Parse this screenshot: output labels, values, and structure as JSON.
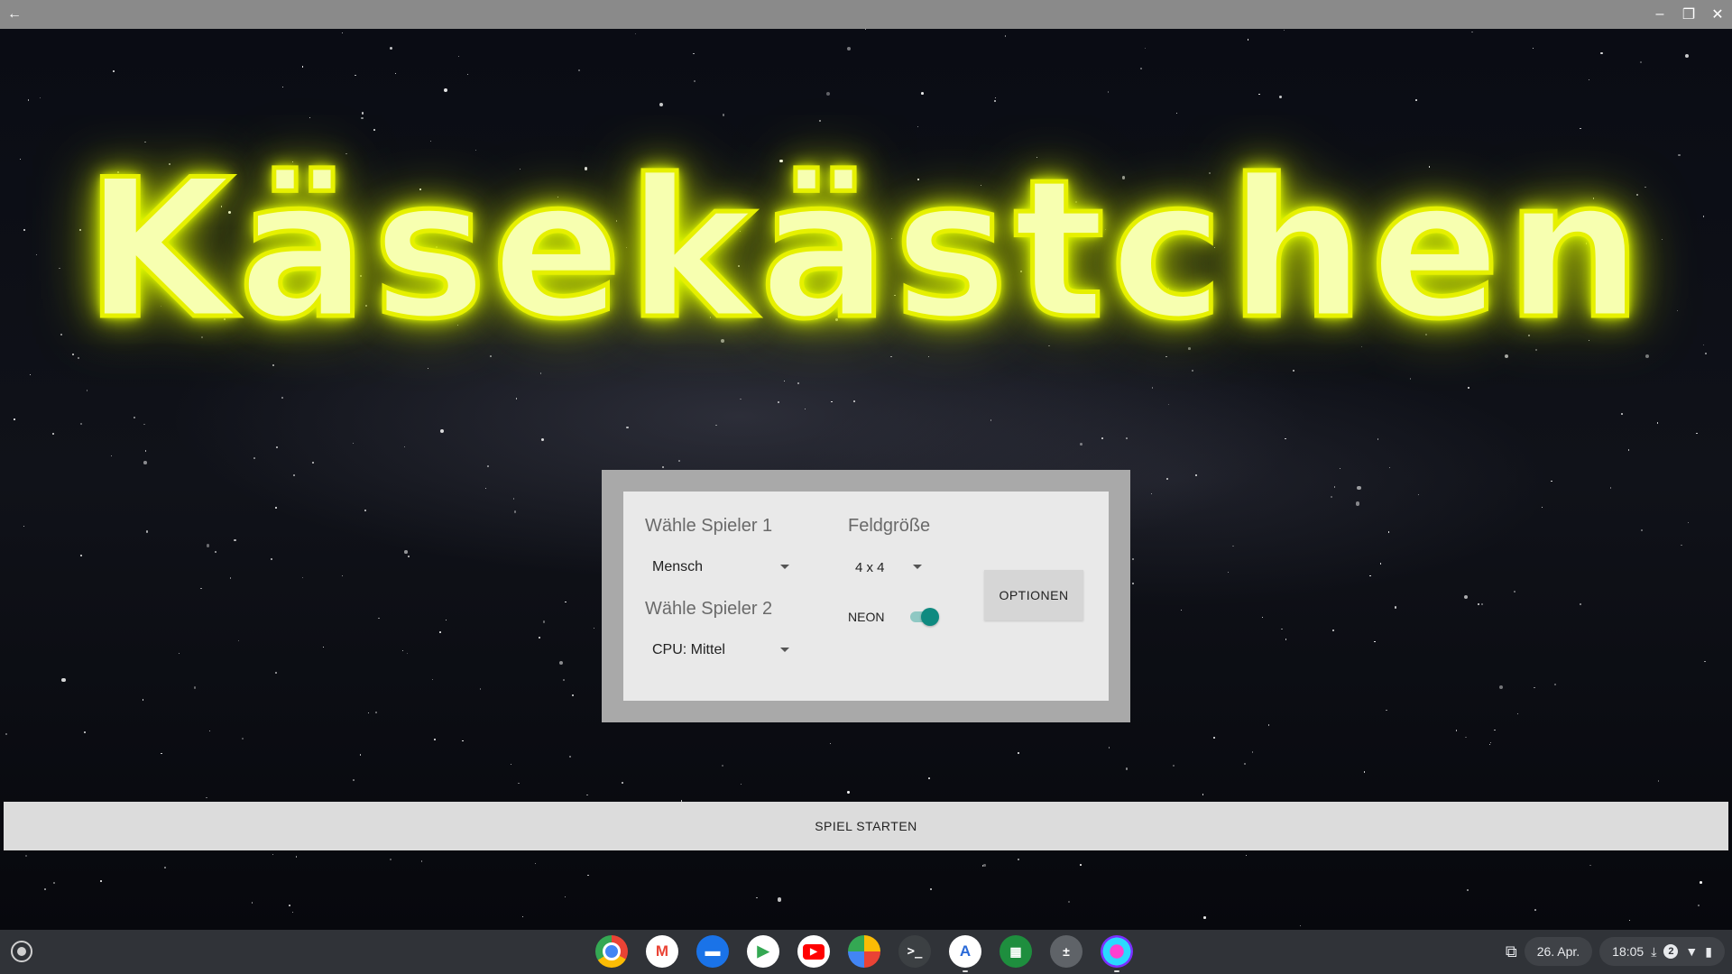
{
  "window": {
    "back_icon": "arrow-left-icon",
    "minimize_icon": "minimize-icon",
    "restore_icon": "restore-icon",
    "close_icon": "close-icon"
  },
  "title": "Käsekästchen",
  "setup": {
    "player1_label": "Wähle Spieler 1",
    "player1_value": "Mensch",
    "player2_label": "Wähle Spieler 2",
    "player2_value": "CPU: Mittel",
    "field_size_label": "Feldgröße",
    "field_size_value": "4 x 4",
    "neon_label": "NEON",
    "neon_on": true,
    "options_button": "OPTIONEN"
  },
  "start_button": "SPIEL STARTEN",
  "shelf": {
    "apps": [
      "Chrome",
      "Gmail",
      "Files",
      "Play Store",
      "YouTube",
      "Photos",
      "Terminal",
      "Android Studio",
      "Sheets",
      "Calculator",
      "Käsekästchen"
    ],
    "date": "26. Apr.",
    "time": "18:05",
    "notification_count": "2"
  },
  "colors": {
    "neon": "#e6f000",
    "toggle": "#0f8a80",
    "shelf": "#303338"
  }
}
